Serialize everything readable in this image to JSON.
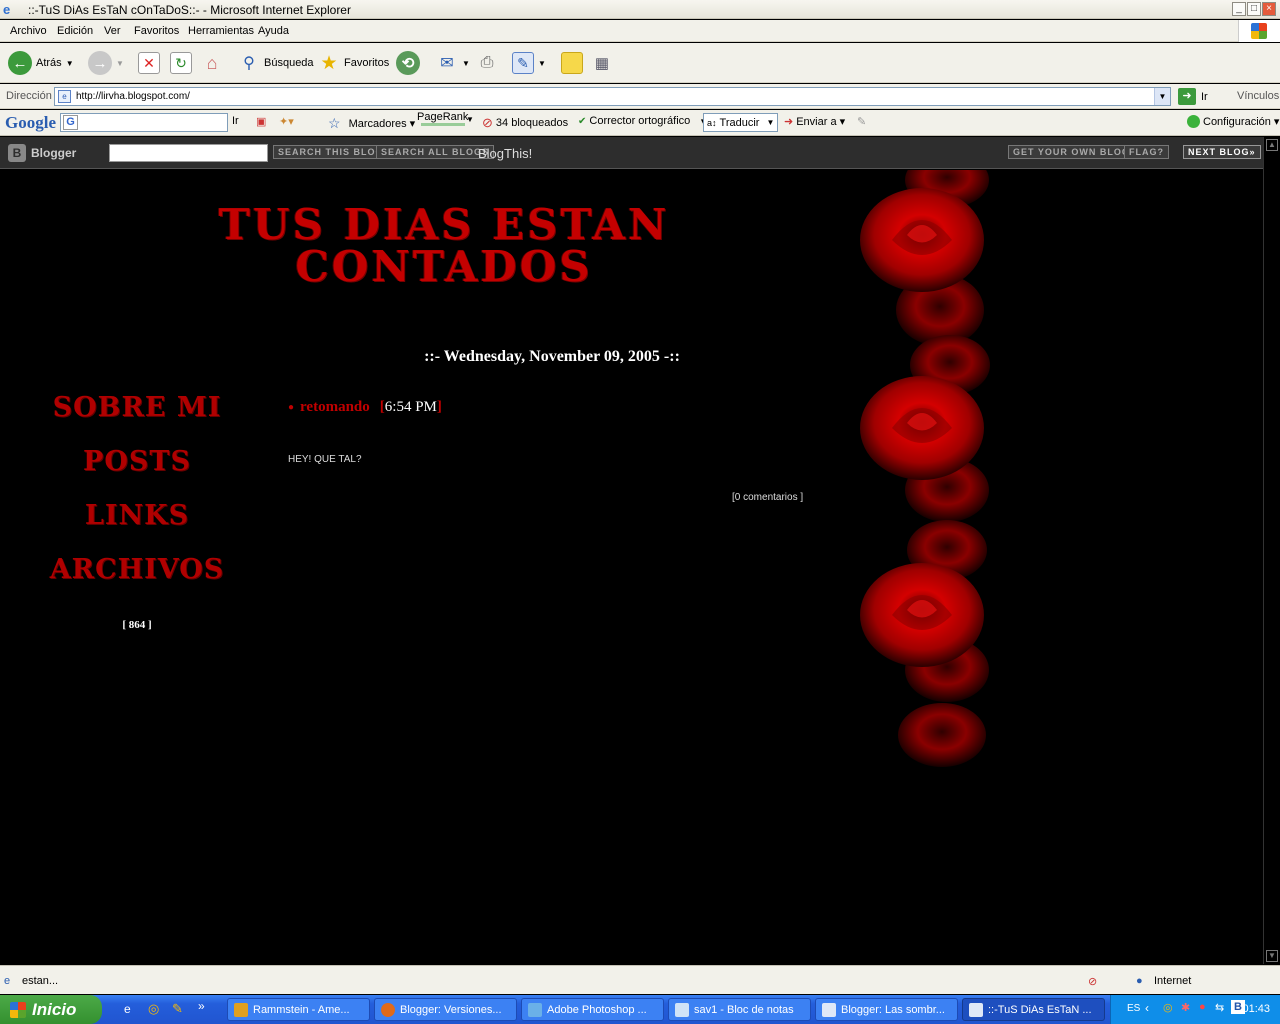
{
  "window": {
    "title": "::-TuS DiAs EsTaN cOnTaDoS::- - Microsoft Internet Explorer"
  },
  "menu": [
    "Archivo",
    "Edición",
    "Ver",
    "Favoritos",
    "Herramientas",
    "Ayuda"
  ],
  "toolbar": {
    "back": "Atrás",
    "search": "Búsqueda",
    "favorites": "Favoritos"
  },
  "address": {
    "label": "Dirección",
    "url": "http://lirvha.blogspot.com/",
    "go": "Ir",
    "links": "Vínculos"
  },
  "google_bar": {
    "logo": "Google",
    "ir": "Ir",
    "bookmarks": "Marcadores",
    "pagerank": "PageRank",
    "blocked": "34 bloqueados",
    "spell": "Corrector ortográfico",
    "translate": "Traducir",
    "send": "Enviar a",
    "settings": "Configuración"
  },
  "blogger_bar": {
    "logo": "Blogger",
    "search_this": "SEARCH THIS BLOG",
    "search_all": "SEARCH ALL BLOGS",
    "blogthis": "BlogThis!",
    "get_own": "GET YOUR OWN BLOG",
    "flag": "FLAG?",
    "next": "NEXT BLOG»"
  },
  "blog": {
    "title_line1": "TUS DIAS ESTAN",
    "title_line2": "CONTADOS",
    "date_header": "::- Wednesday, November 09, 2005 -::",
    "nav": [
      "SOBRE MI",
      "POSTS",
      "LINKS",
      "ARCHIVOS"
    ],
    "counter": "[ 864 ]",
    "post_title": "retomando",
    "post_time": "6:54 PM",
    "post_body": "HEY! QUE TAL?",
    "comments": "[0 comentarios  ]"
  },
  "status": {
    "text": "estan...",
    "zone": "Internet"
  },
  "taskbar": {
    "start": "Inicio",
    "tasks": [
      "Rammstein - Ame...",
      "Blogger: Versiones...",
      "Adobe Photoshop ...",
      "sav1 - Bloc de notas",
      "Blogger: Las sombr...",
      "::-TuS DiAs EsTaN ..."
    ],
    "lang": "ES",
    "clock": "01:43"
  },
  "colors": {
    "accent": "#c00000",
    "background": "#000000"
  }
}
